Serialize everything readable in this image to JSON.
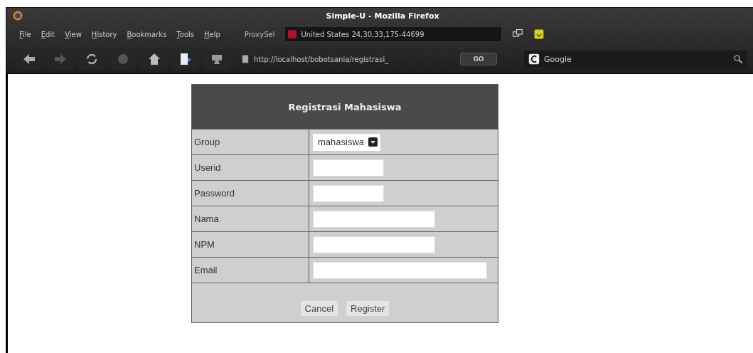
{
  "window": {
    "title": "Simple-U - Mozilla Firefox"
  },
  "menu": [
    "File",
    "Edit",
    "View",
    "History",
    "Bookmarks",
    "Tools",
    "Help"
  ],
  "proxy": {
    "label": "ProxySel",
    "value": "United States 24,30,33,175-44699"
  },
  "toolbar": {
    "url": "http://localhost/bobotsania/registrasi_",
    "go": "GO",
    "search_placeholder": "Google"
  },
  "form": {
    "title": "Registrasi Mahasiswa",
    "fields": [
      {
        "label": "Group",
        "kind": "select",
        "value": "mahasiswa"
      },
      {
        "label": "Userid",
        "kind": "text"
      },
      {
        "label": "Password",
        "kind": "password"
      },
      {
        "label": "Nama",
        "kind": "text"
      },
      {
        "label": "NPM",
        "kind": "text"
      },
      {
        "label": "Email",
        "kind": "text"
      }
    ],
    "buttons": [
      "Cancel",
      "Register"
    ]
  }
}
